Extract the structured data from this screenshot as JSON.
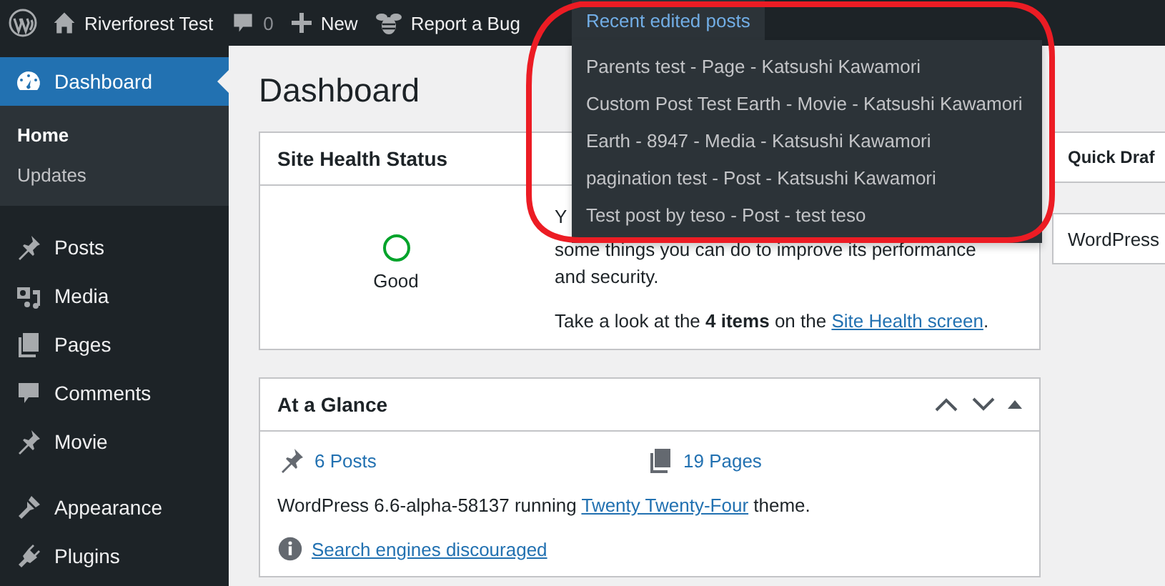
{
  "admin_bar": {
    "site_name": "Riverforest Test",
    "comments_count": "0",
    "new_label": "New",
    "report_label": "Report a Bug",
    "recent_menu": {
      "label": "Recent edited posts",
      "expanded": true,
      "items": [
        "Parents test - Page - Katsushi Kawamori",
        "Custom Post Test Earth - Movie - Katsushi Kawamori",
        "Earth - 8947 - Media - Katsushi Kawamori",
        "pagination test - Post - Katsushi Kawamori",
        "Test post by teso - Post - test teso"
      ]
    }
  },
  "sidebar": {
    "menu_groups": [
      [
        {
          "label": "Dashboard",
          "kind": "dashboard",
          "selected": true,
          "children": [
            {
              "label": "Home",
              "selected": true
            },
            {
              "label": "Updates",
              "selected": false
            }
          ]
        }
      ],
      [
        {
          "label": "Posts",
          "kind": "pin",
          "selected": false
        },
        {
          "label": "Media",
          "kind": "media",
          "selected": false
        },
        {
          "label": "Pages",
          "kind": "pages",
          "selected": false
        },
        {
          "label": "Comments",
          "kind": "comment",
          "selected": false
        },
        {
          "label": "Movie",
          "kind": "pin",
          "selected": false
        }
      ],
      [
        {
          "label": "Appearance",
          "kind": "brush",
          "selected": false
        },
        {
          "label": "Plugins",
          "kind": "plug",
          "selected": false
        }
      ]
    ]
  },
  "page_title": "Dashboard",
  "site_health": {
    "title": "Site Health Status",
    "status": "Good",
    "description_lines": [
      "Y",
      "some things you can do to improve its performance",
      "and security."
    ],
    "summary": "Take a look at the **4 items** on the ",
    "summary_link": "Site Health screen",
    "summary_end": "."
  },
  "side_cards": [
    "Quick Draf",
    "WordPress"
  ],
  "at_a_glance": {
    "title": "At a Glance",
    "counts": [
      {
        "kind": "pin",
        "label": "6 Posts"
      },
      {
        "kind": "pages",
        "label": "19 Pages"
      }
    ],
    "version_text": "WordPress 6.6-alpha-58137 running ",
    "theme_link": "Twenty Twenty-Four",
    "version_end": " theme.",
    "notice": "Search engines discouraged"
  }
}
